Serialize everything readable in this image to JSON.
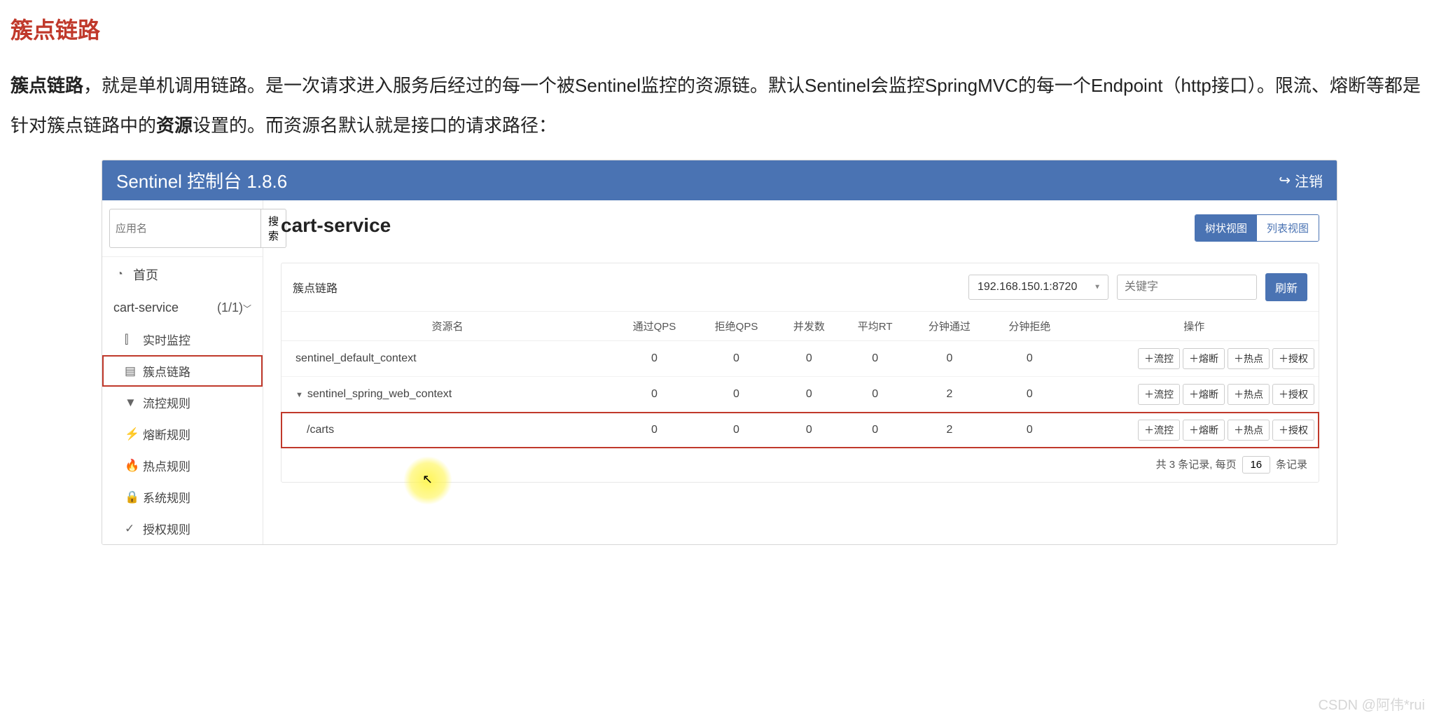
{
  "doc": {
    "title": "簇点链路",
    "para_bold1": "簇点链路",
    "para_text1": "，就是单机调用链路。是一次请求进入服务后经过的每一个被Sentinel监控的资源链。默认Sentinel会监控SpringMVC的每一个Endpoint（http接口）。限流、熔断等都是针对簇点链路中的",
    "para_bold2": "资源",
    "para_text2": "设置的。而资源名默认就是接口的请求路径："
  },
  "header": {
    "title": "Sentinel 控制台 1.8.6",
    "logout": "注销"
  },
  "sidebar": {
    "search_placeholder": "应用名",
    "search_btn": "搜索",
    "home": "首页",
    "app_name": "cart-service",
    "app_count": "(1/1)",
    "items": [
      {
        "icon": "bar-icon",
        "glyph": "⫿",
        "label": "实时监控"
      },
      {
        "icon": "list-icon",
        "glyph": "▤",
        "label": "簇点链路",
        "selected": true
      },
      {
        "icon": "filter-icon",
        "glyph": "▼",
        "label": "流控规则"
      },
      {
        "icon": "bolt-icon",
        "glyph": "⚡",
        "label": "熔断规则"
      },
      {
        "icon": "fire-icon",
        "glyph": "🔥",
        "label": "热点规则"
      },
      {
        "icon": "lock-icon",
        "glyph": "🔒",
        "label": "系统规则"
      },
      {
        "icon": "check-icon",
        "glyph": "✓",
        "label": "授权规则"
      }
    ]
  },
  "main": {
    "title": "cart-service",
    "view_tree": "树状视图",
    "view_list": "列表视图",
    "panel_label": "簇点链路",
    "host_selected": "192.168.150.1:8720",
    "keyword_placeholder": "关键字",
    "refresh": "刷新",
    "columns": {
      "name": "资源名",
      "pass_qps": "通过QPS",
      "block_qps": "拒绝QPS",
      "thread": "并发数",
      "rt": "平均RT",
      "min_pass": "分钟通过",
      "min_block": "分钟拒绝",
      "ops": "操作"
    },
    "op_labels": {
      "flow": "流控",
      "degrade": "熔断",
      "hotspot": "热点",
      "auth": "授权"
    },
    "rows": [
      {
        "name": "sentinel_default_context",
        "pass_qps": "0",
        "block_qps": "0",
        "thread": "0",
        "rt": "0",
        "min_pass": "0",
        "min_block": "0",
        "indent": 1,
        "expandable": false
      },
      {
        "name": "sentinel_spring_web_context",
        "pass_qps": "0",
        "block_qps": "0",
        "thread": "0",
        "rt": "0",
        "min_pass": "2",
        "min_block": "0",
        "indent": 1,
        "expandable": true
      },
      {
        "name": "/carts",
        "pass_qps": "0",
        "block_qps": "0",
        "thread": "0",
        "rt": "0",
        "min_pass": "2",
        "min_block": "0",
        "indent": 2,
        "highlight": true
      }
    ],
    "pager": {
      "prefix": "共 3 条记录, 每页",
      "size": "16",
      "suffix": "条记录"
    }
  },
  "watermark": "CSDN @阿伟*rui"
}
